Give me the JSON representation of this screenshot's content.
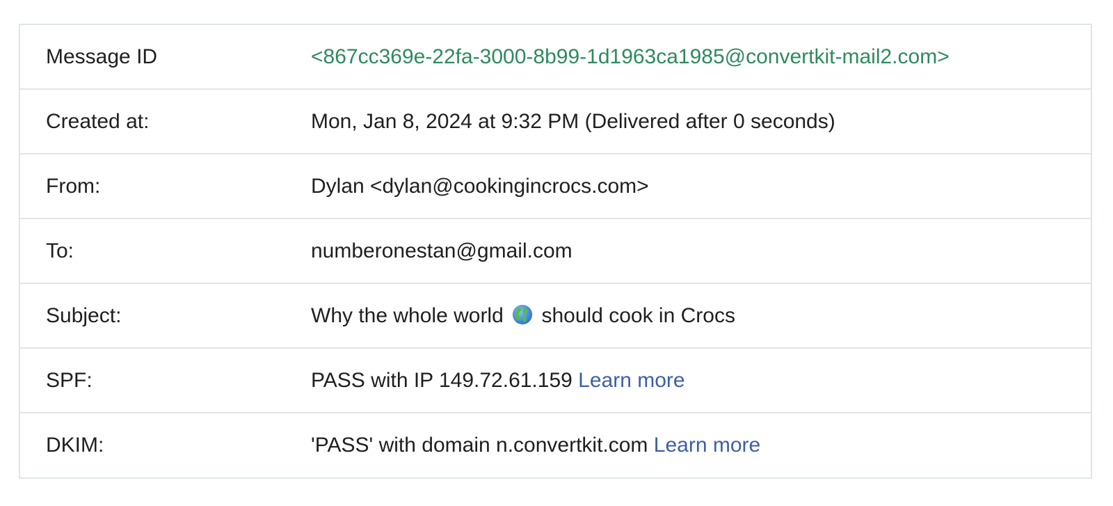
{
  "rows": {
    "message_id": {
      "label": "Message ID",
      "value": "<867cc369e-22fa-3000-8b99-1d1963ca1985@convertkit-mail2.com>"
    },
    "created_at": {
      "label": "Created at:",
      "value": "Mon, Jan 8, 2024 at 9:32 PM (Delivered after 0 seconds)"
    },
    "from": {
      "label": "From:",
      "value": "Dylan <dylan@cookingincrocs.com>"
    },
    "to": {
      "label": "To:",
      "value": "numberonestan@gmail.com"
    },
    "subject": {
      "label": "Subject:",
      "value_before": "Why the whole world",
      "icon": "globe-icon",
      "value_after": "should cook in Crocs"
    },
    "spf": {
      "label": "SPF:",
      "value": "PASS with IP 149.72.61.159",
      "link": "Learn more"
    },
    "dkim": {
      "label": "DKIM:",
      "value": "'PASS' with domain n.convertkit.com",
      "link": "Learn more"
    }
  },
  "colors": {
    "message_id_text": "#2e8a5e",
    "link": "#3f5fa6",
    "border": "#e1e5e9",
    "text": "#1f1f1f"
  }
}
